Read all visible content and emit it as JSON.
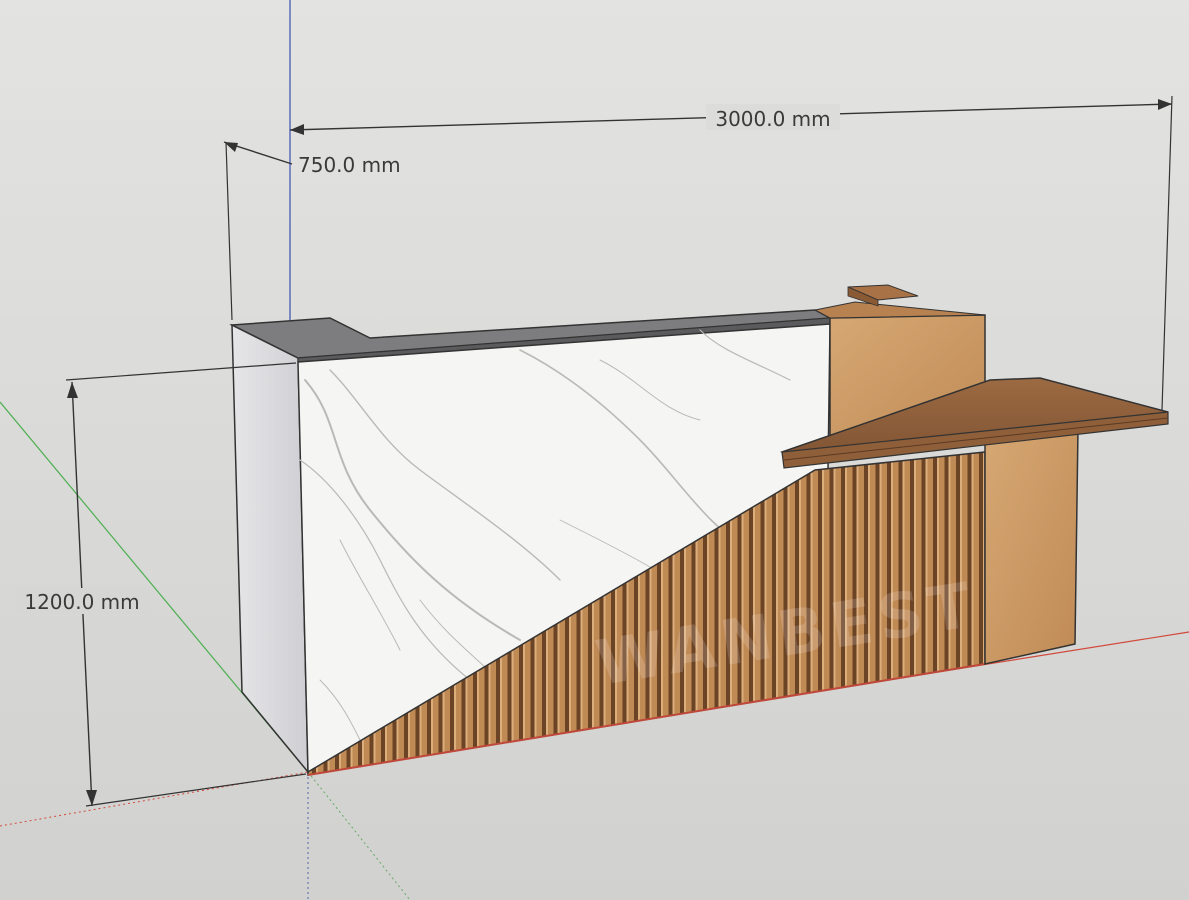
{
  "viewport": {
    "background": "#d9d8d4",
    "axis_colors": {
      "red": "#d24a3c",
      "green": "#4caf50",
      "blue": "#3a4fb0"
    }
  },
  "dimensions": {
    "width": "3000.0 mm",
    "depth": "750.0 mm",
    "height": "1200.0 mm"
  },
  "model": {
    "materials": {
      "marble": "#f4f4f2",
      "wood": "#c99660",
      "wood_dark": "#8a5a35",
      "slat_shadow": "#6b4325",
      "top_gray": "#7f7f80"
    }
  }
}
